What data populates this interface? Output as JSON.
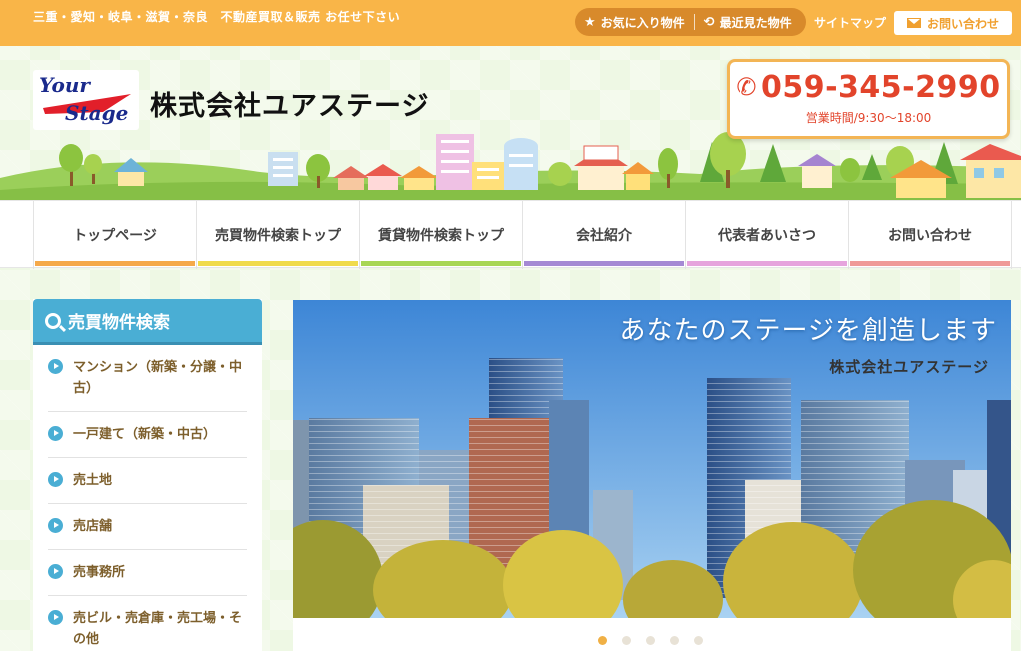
{
  "topbar": {
    "tagline": "三重・愛知・岐阜・滋賀・奈良　不動産買取＆販売 お任せ下さい",
    "favorites": "お気に入り物件",
    "recent": "最近見た物件",
    "sitemap": "サイトマップ",
    "contact": "お問い合わせ",
    "favorites_icon": "star-icon",
    "recent_icon": "history-icon",
    "contact_icon": "mail-icon"
  },
  "header": {
    "logo_line1": "Your",
    "logo_line2": "Stage",
    "company_name": "株式会社ユアステージ",
    "phone": "059-345-2990",
    "hours": "営業時間/9:30〜18:00",
    "phone_icon": "phone-icon"
  },
  "nav": {
    "items": [
      {
        "label": "トップページ",
        "color": "#f5a94a"
      },
      {
        "label": "売買物件検索トップ",
        "color": "#f0db4c"
      },
      {
        "label": "賃貸物件検索トップ",
        "color": "#a8d655"
      },
      {
        "label": "会社紹介",
        "color": "#a58ad4"
      },
      {
        "label": "代表者あいさつ",
        "color": "#e6a4dd"
      },
      {
        "label": "お問い合わせ",
        "color": "#ef9a98"
      }
    ]
  },
  "sidebar": {
    "title": "売買物件検索",
    "items": [
      {
        "label": "マンション（新築・分譲・中古）"
      },
      {
        "label": "一戸建て（新築・中古）"
      },
      {
        "label": "売土地"
      },
      {
        "label": "売店舗"
      },
      {
        "label": "売事務所"
      },
      {
        "label": "売ビル・売倉庫・売工場・その他"
      }
    ]
  },
  "hero": {
    "title": "あなたのステージを創造します",
    "subtitle": "株式会社ユアステージ",
    "slide_count": 5,
    "active_slide": 1
  }
}
